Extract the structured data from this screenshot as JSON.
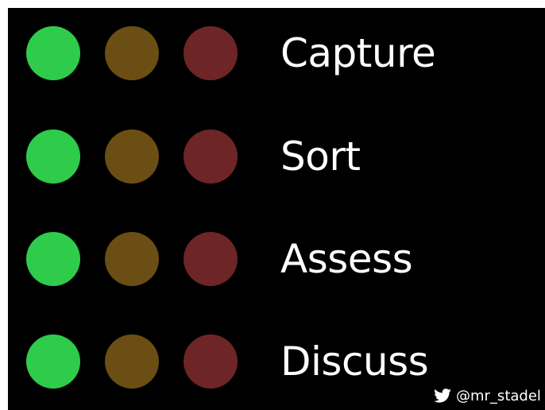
{
  "slide": {
    "items": [
      {
        "label": "Capture"
      },
      {
        "label": "Sort"
      },
      {
        "label": "Assess"
      },
      {
        "label": "Discuss"
      }
    ],
    "dot_colors": {
      "green": "#2ecc4a",
      "brown": "#6b4e14",
      "red": "#6e2525"
    }
  },
  "footer": {
    "icon": "twitter-bird-icon",
    "handle": "@mr_stadel"
  }
}
